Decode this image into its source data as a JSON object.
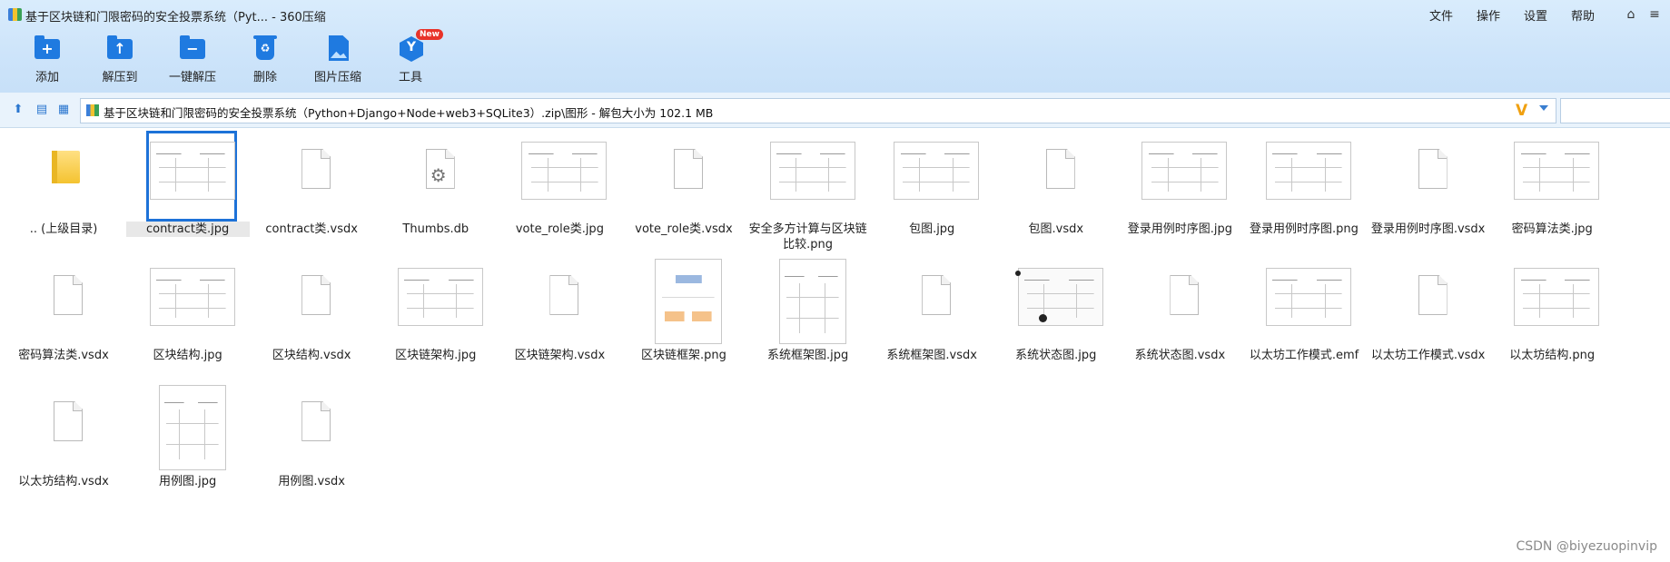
{
  "window": {
    "title": "基于区块链和门限密码的安全投票系统（Pyt... - 360压缩",
    "menus": [
      "文件",
      "操作",
      "设置",
      "帮助"
    ]
  },
  "toolbar": [
    {
      "label": "添加",
      "icon": "add-folder-icon"
    },
    {
      "label": "解压到",
      "icon": "extract-to-icon"
    },
    {
      "label": "一键解压",
      "icon": "one-click-extract-icon"
    },
    {
      "label": "删除",
      "icon": "delete-icon"
    },
    {
      "label": "图片压缩",
      "icon": "image-compress-icon"
    },
    {
      "label": "工具",
      "icon": "tools-icon",
      "badge": "New"
    }
  ],
  "address": {
    "path": "基于区块链和门限密码的安全投票系统（Python+Django+Node+web3+SQLite3）.zip\\图形 - 解包大小为 102.1 MB"
  },
  "files": [
    {
      "name": ".. (上级目录)",
      "kind": "parent"
    },
    {
      "name": "contract类.jpg",
      "kind": "image",
      "selected": true
    },
    {
      "name": "contract类.vsdx",
      "kind": "doc"
    },
    {
      "name": "Thumbs.db",
      "kind": "db"
    },
    {
      "name": "vote_role类.jpg",
      "kind": "image"
    },
    {
      "name": "vote_role类.vsdx",
      "kind": "doc"
    },
    {
      "name": "安全多方计算与区块链比较.png",
      "kind": "image"
    },
    {
      "name": "包图.jpg",
      "kind": "image"
    },
    {
      "name": "包图.vsdx",
      "kind": "doc"
    },
    {
      "name": "登录用例时序图.jpg",
      "kind": "image"
    },
    {
      "name": "登录用例时序图.png",
      "kind": "image"
    },
    {
      "name": "登录用例时序图.vsdx",
      "kind": "doc"
    },
    {
      "name": "密码算法类.jpg",
      "kind": "image"
    },
    {
      "name": "密码算法类.vsdx",
      "kind": "doc"
    },
    {
      "name": "区块结构.jpg",
      "kind": "image"
    },
    {
      "name": "区块结构.vsdx",
      "kind": "doc"
    },
    {
      "name": "区块链架构.jpg",
      "kind": "image"
    },
    {
      "name": "区块链架构.vsdx",
      "kind": "doc"
    },
    {
      "name": "区块链框架.png",
      "kind": "image-color"
    },
    {
      "name": "系统框架图.jpg",
      "kind": "image-tall"
    },
    {
      "name": "系统框架图.vsdx",
      "kind": "doc"
    },
    {
      "name": "系统状态图.jpg",
      "kind": "image-state"
    },
    {
      "name": "系统状态图.vsdx",
      "kind": "doc"
    },
    {
      "name": "以太坊工作模式.emf",
      "kind": "image"
    },
    {
      "name": "以太坊工作模式.vsdx",
      "kind": "doc"
    },
    {
      "name": "以太坊结构.png",
      "kind": "image"
    },
    {
      "name": "以太坊结构.vsdx",
      "kind": "doc"
    },
    {
      "name": "用例图.jpg",
      "kind": "image-tall"
    },
    {
      "name": "用例图.vsdx",
      "kind": "doc"
    }
  ],
  "watermark": "CSDN @biyezuopinvip",
  "colors": {
    "accent": "#1d72d8",
    "toolbar_icon": "#1f7ae0",
    "badge": "#e8332a"
  }
}
